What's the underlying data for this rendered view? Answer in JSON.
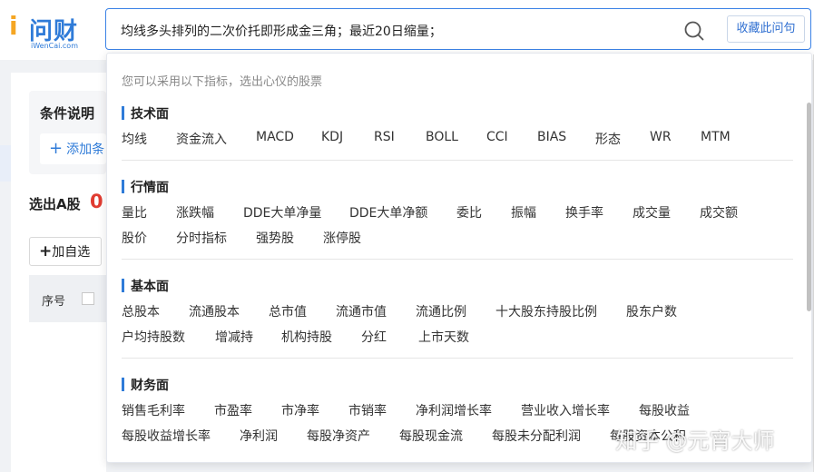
{
  "logo": {
    "mark": "i",
    "name": "问财",
    "sub": "iWenCai.com"
  },
  "search": {
    "query": "均线多头排列的二次价托即形成金三角；最近20日缩量；",
    "favorite_label": "收藏此问句"
  },
  "left": {
    "condition_title": "条件说明",
    "add_condition": "添加条",
    "selected_label": "选出A股",
    "selected_count": "0",
    "add_watchlist": "加自选",
    "col_seq": "序号"
  },
  "dropdown": {
    "hint": "您可以采用以下指标，选出心仪的股票",
    "sections": [
      {
        "title": "技术面",
        "items": [
          "均线",
          "资金流入",
          "MACD",
          "KDJ",
          "RSI",
          "BOLL",
          "CCI",
          "BIAS",
          "形态",
          "WR",
          "MTM"
        ]
      },
      {
        "title": "行情面",
        "items": [
          "量比",
          "涨跌幅",
          "DDE大单净量",
          "DDE大单净额",
          "委比",
          "振幅",
          "换手率",
          "成交量",
          "成交额",
          "股价",
          "分时指标",
          "强势股",
          "涨停股"
        ]
      },
      {
        "title": "基本面",
        "items": [
          "总股本",
          "流通股本",
          "总市值",
          "流通市值",
          "流通比例",
          "十大股东持股比例",
          "股东户数",
          "户均持股数",
          "增减持",
          "机构持股",
          "分红",
          "上市天数"
        ]
      },
      {
        "title": "财务面",
        "items": [
          "销售毛利率",
          "市盈率",
          "市净率",
          "市销率",
          "净利润增长率",
          "营业收入增长率",
          "每股收益",
          "每股收益增长率",
          "净利润",
          "每股净资产",
          "每股现金流",
          "每股未分配利润",
          "每股资本公积"
        ]
      }
    ]
  },
  "watermark": "知乎 @元宵大师",
  "colors": {
    "accent": "#2f7bd8",
    "count_red": "#e03c31",
    "logo_orange": "#f5a623"
  }
}
